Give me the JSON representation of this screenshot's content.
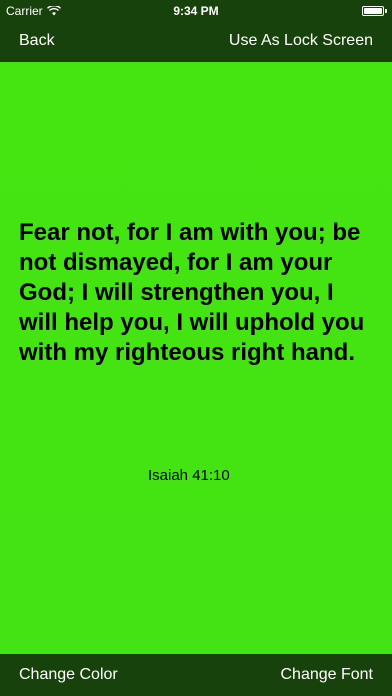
{
  "status_bar": {
    "carrier": "Carrier",
    "time": "9:34 PM",
    "battery_level": 1.0,
    "wifi_icon": "wifi-icon",
    "battery_icon": "battery-icon"
  },
  "nav": {
    "back_label": "Back",
    "lock_label": "Use As Lock Screen"
  },
  "quote": {
    "text": "Fear not, for I am with you; be not dismayed, for I am your God; I will strengthen you, I will help you, I will uphold you with my righteous right hand.",
    "reference": "Isaiah 41:10"
  },
  "bottom": {
    "change_color_label": "Change Color",
    "change_font_label": "Change Font"
  },
  "colors": {
    "bar_background": "#18420c",
    "content_background": "#45e511",
    "text_on_bar": "#ffffff",
    "quote_text": "#000000"
  }
}
